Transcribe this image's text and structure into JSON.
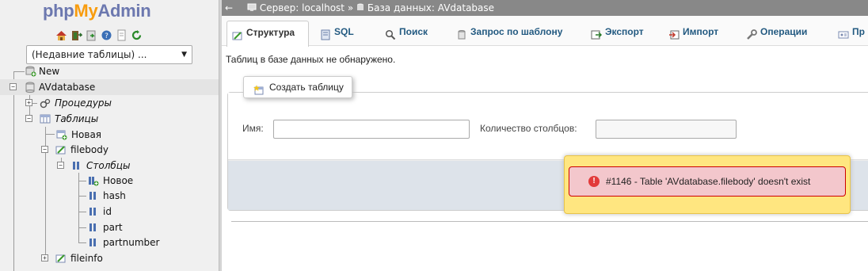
{
  "app": {
    "logo_php": "php",
    "logo_my": "My",
    "logo_admin": "Admin"
  },
  "nav_icons": [
    "home-icon",
    "exit-icon",
    "sql-query-icon",
    "help-icon",
    "docs-icon",
    "reload-icon"
  ],
  "recent_tables": {
    "value": "(Недавние таблицы) ...",
    "caret": "▼"
  },
  "tree": {
    "new_label": "New",
    "db_name": "AVdatabase",
    "procedures_label": "Процедуры",
    "tables_label": "Таблицы",
    "new_table_label": "Новая",
    "table1": "filebody",
    "columns_label": "Столбцы",
    "new_column_label": "Новое",
    "columns": [
      "hash",
      "id",
      "part",
      "partnumber"
    ],
    "table2": "fileinfo",
    "plus": "+",
    "minus": "−"
  },
  "topbar": {
    "back": "←",
    "server": "Сервер: localhost",
    "sep": "»",
    "database": "База данных: AVdatabase"
  },
  "tabs": [
    {
      "label": "Структура",
      "icon": "structure-icon",
      "active": true
    },
    {
      "label": "SQL",
      "icon": "sql-icon"
    },
    {
      "label": "Поиск",
      "icon": "search-icon"
    },
    {
      "label": "Запрос по шаблону",
      "icon": "query-icon"
    },
    {
      "label": "Экспорт",
      "icon": "export-icon"
    },
    {
      "label": "Импорт",
      "icon": "import-icon"
    },
    {
      "label": "Операции",
      "icon": "operations-icon"
    },
    {
      "label": "Пр",
      "icon": "privileges-icon"
    }
  ],
  "main": {
    "no_tables_notice": "Таблиц в базе данных не обнаружено.",
    "create_table_label": "Создать таблицу",
    "name_label": "Имя:",
    "name_value": "",
    "columns_count_label": "Количество столбцов:",
    "columns_count_value": ""
  },
  "error": {
    "icon_glyph": "!",
    "message": "#1146 - Table 'AVdatabase.filebody' doesn't exist"
  },
  "colors": {
    "accent": "#235a81",
    "logo_blue": "#6c78af",
    "logo_orange": "#f89c0e",
    "error_bg": "#f3c7cc",
    "error_wrap": "#ffe680"
  }
}
